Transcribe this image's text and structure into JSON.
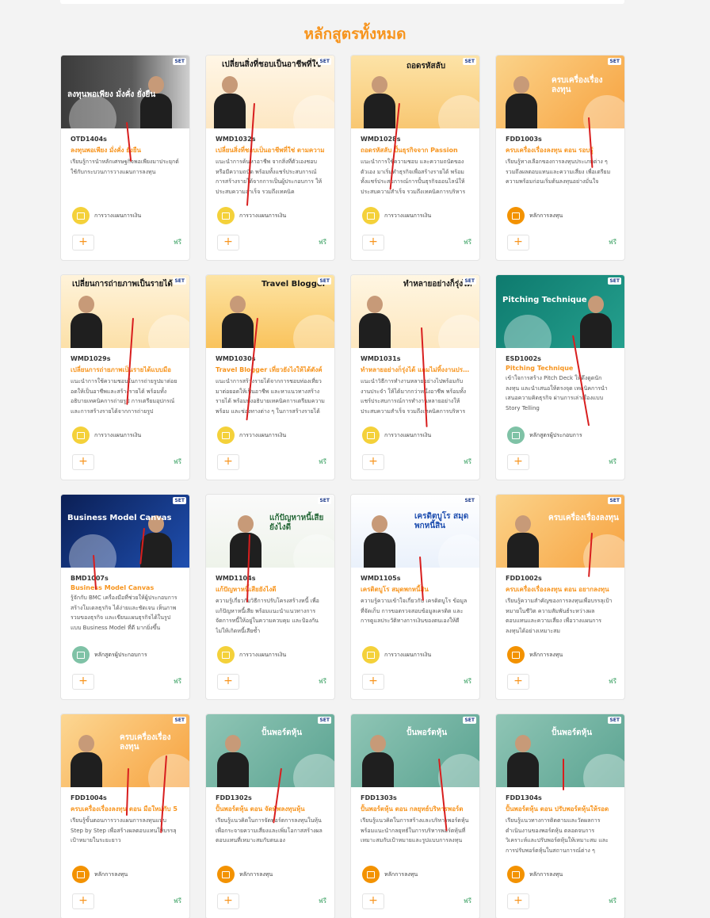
{
  "section": {
    "heading": "หลักสูตรทั้งหมด"
  },
  "price_label": "ฟรี",
  "add_label": "+",
  "colors": {
    "accent": "#f7941d",
    "free": "#2f9c5a",
    "cat_finance": "#f4d13a",
    "cat_invest": "#f39200",
    "cat_entrepreneur": "#7fc2a6"
  },
  "courses": [
    {
      "code": "OTD1404s",
      "title": "ลงทุนพอเพียง มั่งคั่ง ยั่งยืน",
      "desc": "เรียนรู้การนำหลักเศรษฐกิจพอเพียงมาประยุกต์ใช้กับกระบวนการวางแผนการลงทุน",
      "category": "การวางแผนการเงิน",
      "cat_color": "#f4d13a",
      "thumb_text": "ลงทุนพอเพียง มั่งคั่ง ยั่งยืน"
    },
    {
      "code": "WMD1032s",
      "title": "เปลี่ยนสิ่งที่ชอบเป็นอาชีพที่ใช่ ตามความ",
      "desc": "แนะนำการค้นหาอาชีพ จากสิ่งที่ตัวเองชอบหรือมีความถนัด พร้อมทั้งแชร์ประสบการณ์การสร้างรายได้จากการเป็นผู้ประกอบการ ให้ประสบความสำเร็จ รวมถึงเทคนิค",
      "category": "การวางแผนการเงิน",
      "cat_color": "#f4d13a",
      "thumb_text": "เปลี่ยนสิ่งที่ชอบเป็นอาชีพที่ใช่"
    },
    {
      "code": "WMD1028s",
      "title": "ถอดรหัสลับ ปั้นธุรกิจจาก Passion",
      "desc": "แนะนำการใช้ความชอบ และความถนัดของตัวเอง มาเริ่มทำธุรกิจเพื่อสร้างรายได้ พร้อมทั้งแชร์ประสบการณ์การปั้นธุรกิจออนไลน์ให้ประสบความสำเร็จ รวมถึงเทคนิคการบริหาร",
      "category": "การวางแผนการเงิน",
      "cat_color": "#f4d13a",
      "thumb_text": "ถอดรหัสลับ"
    },
    {
      "code": "FDD1003s",
      "title": "ครบเครื่องเรื่องลงทุน ตอน รอบรู้",
      "desc": "เรียนรู้ทางเลือกของการลงทุนประเภทต่าง ๆ รวมถึงผลตอบแทนและความเสี่ยง เพื่อเตรียมความพร้อมก่อนเริ่มต้นลงทุนอย่างมั่นใจ",
      "category": "หลักการลงทุน",
      "cat_color": "#f39200",
      "thumb_text": "ครบเครื่องเรื่องลงทุน"
    },
    {
      "code": "WMD1029s",
      "title": "เปลี่ยนการถ่ายภาพเป็นรายได้แบบมือ",
      "desc": "แนะนำการใช้ความชอบในการถ่ายรูปมาต่อยอดให้เป็นอาชีพและสร้างรายได้ พร้อมทั้งอธิบายเทคนิคการถ่ายรูป การเตรียมอุปกรณ์ และการสร้างรายได้จากการถ่ายรูป",
      "category": "การวางแผนการเงิน",
      "cat_color": "#f4d13a",
      "thumb_text": "เปลี่ยนการถ่ายภาพเป็นรายได้"
    },
    {
      "code": "WMD1030s",
      "title": "Travel Blogger เที่ยวยังไงให้ได้ตังค์",
      "desc": "แนะนำการสร้างรายได้จากการชอบท่องเที่ยว มาต่อยอดให้เป็นอาชีพ และหาแนวทางสร้างรายได้ พร้อมทั้งอธิบายเทคนิคการเตรียมความพร้อม และช่องทางต่าง ๆ ในการสร้างรายได้",
      "category": "การวางแผนการเงิน",
      "cat_color": "#f4d13a",
      "thumb_text": "Travel Blogger"
    },
    {
      "code": "WMD1031s",
      "title": "ทำหลายอย่างก็รุ่งได้ แถมไม่ทิ้งงานประจำ",
      "desc": "แนะนำวิธีการทำงานหลายอย่างไปพร้อมกับงานประจำ ให้ได้มากกว่าหนึ่งอาชีพ พร้อมทั้งแชร์ประสบการณ์การทำงานหลายอย่างให้ประสบความสำเร็จ รวมถึงเทคนิคการบริหารความเสี่ยง",
      "category": "การวางแผนการเงิน",
      "cat_color": "#f4d13a",
      "thumb_text": "ทำหลายอย่างก็รุ่งได้"
    },
    {
      "code": "ESD1002s",
      "title": "Pitching Technique",
      "desc": "เข้าใจการสร้าง Pitch Deck ให้ดึงดูดนักลงทุน และนำเสนอให้ตรงจุด เทคนิคการนำเสนอความคิดธุรกิจ ผ่านการเล่าเรื่องแบบ Story Telling",
      "category": "หลักสูตรผู้ประกอบการ",
      "cat_color": "#7fc2a6",
      "thumb_text": "Pitching Technique"
    },
    {
      "code": "BMD1007s",
      "title": "Business Model Canvas",
      "desc": "รู้จักกับ BMC เครื่องมือที่ช่วยให้ผู้ประกอบการสร้างโมเดลธุรกิจ ได้ง่ายและชัดเจน เห็นภาพรวมของธุรกิจ และเขียนแผนธุรกิจได้ในรูปแบบ Business Model ที่ดี มากยิ่งขึ้น",
      "category": "หลักสูตรผู้ประกอบการ",
      "cat_color": "#7fc2a6",
      "thumb_text": "Business Model Canvas"
    },
    {
      "code": "WMD1104s",
      "title": "แก้ปัญหาหนี้เสียยังไงดี",
      "desc": "ความรู้เกี่ยวกับวิธีการปรับโครงสร้างหนี้ เพื่อแก้ปัญหาหนี้เสีย พร้อมแนะนำแนวทางการจัดการหนี้ให้อยู่ในความควบคุม และป้องกันไม่ให้เกิดหนี้เสียซ้ำ",
      "category": "การวางแผนการเงิน",
      "cat_color": "#f4d13a",
      "thumb_text": "แก้ปัญหาหนี้เสีย ยังไงดี"
    },
    {
      "code": "WMD1105s",
      "title": "เครดิตบูโร สมุดพกหนี้สิน",
      "desc": "ความรู้ความเข้าใจเกี่ยวกับ เครดิตบูโร ข้อมูลที่จัดเก็บ การขอตรวจสอบข้อมูลเครดิต และการดูแลประวัติทางการเงินของตนเองให้ดี",
      "category": "การวางแผนการเงิน",
      "cat_color": "#f4d13a",
      "thumb_text": "เครดิตบูโร สมุดพกหนี้สิน"
    },
    {
      "code": "FDD1002s",
      "title": "ครบเครื่องเรื่องลงทุน ตอน อยากลงทุน",
      "desc": "เรียนรู้ความสำคัญของการลงทุนเพื่อบรรลุเป้าหมายในชีวิต ความสัมพันธ์ระหว่างผลตอบแทนและความเสี่ยง เพื่อวางแผนการลงทุนได้อย่างเหมาะสม",
      "category": "หลักการลงทุน",
      "cat_color": "#f39200",
      "thumb_text": "ครบเครื่องเรื่องลงทุน"
    },
    {
      "code": "FDD1004s",
      "title": "ครบเครื่องเรื่องลงทุน ตอน มือใหม่กับ 5",
      "desc": "เรียนรู้ขั้นตอนการวางแผนการลงทุนแบบ Step by Step เพื่อสร้างผลตอบแทนให้บรรลุเป้าหมายในระยะยาว",
      "category": "หลักการลงทุน",
      "cat_color": "#f39200",
      "thumb_text": "ครบเครื่องเรื่องลงทุน"
    },
    {
      "code": "FDD1302s",
      "title": "ปั้นพอร์ตหุ้น ตอน จัดทัพลงทุนหุ้น",
      "desc": "เรียนรู้แนวคิดในการจัดพอร์ตการลงทุนในหุ้น เพื่อกระจายความเสี่ยงและเพิ่มโอกาสสร้างผลตอบแทนที่เหมาะสมกับตนเอง",
      "category": "หลักการลงทุน",
      "cat_color": "#f39200",
      "thumb_text": "ปั้นพอร์ตหุ้น"
    },
    {
      "code": "FDD1303s",
      "title": "ปั้นพอร์ตหุ้น ตอน กลยุทธ์บริหารพอร์ต",
      "desc": "เรียนรู้แนวคิดในการสร้างและบริหารพอร์ตหุ้น พร้อมแนะนำกลยุทธ์ในการบริหารพอร์ตหุ้นที่เหมาะสมกับเป้าหมายและรูปแบบการลงทุน",
      "category": "หลักการลงทุน",
      "cat_color": "#f39200",
      "thumb_text": "ปั้นพอร์ตหุ้น"
    },
    {
      "code": "FDD1304s",
      "title": "ปั้นพอร์ตหุ้น ตอน ปรับพอร์ตหุ้นให้รอด",
      "desc": "เรียนรู้แนวทางการติดตามและวัดผลการดำเนินงานของพอร์ตหุ้น ตลอดจนการวิเคราะห์และปรับพอร์ตหุ้นให้เหมาะสม และการปรับพอร์ตหุ้นในสถานการณ์ต่าง ๆ",
      "category": "หลักการลงทุน",
      "cat_color": "#f39200",
      "thumb_text": "ปั้นพอร์ตหุ้น"
    }
  ]
}
